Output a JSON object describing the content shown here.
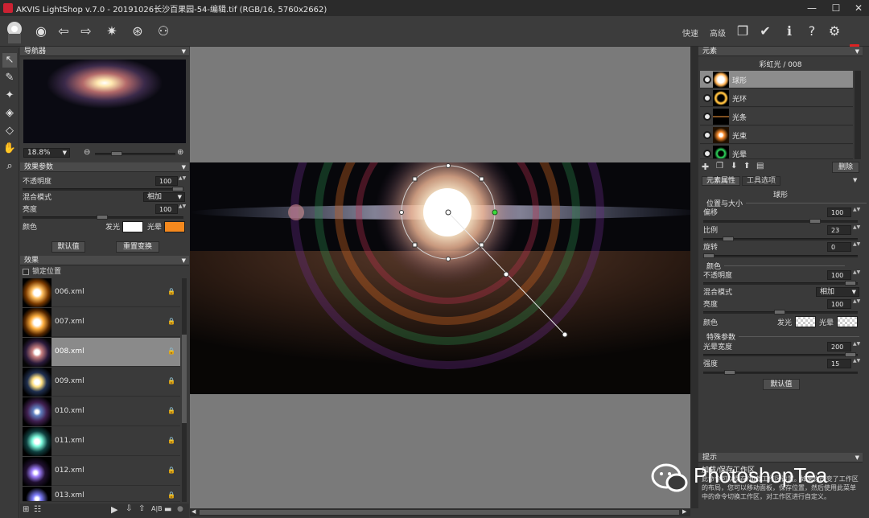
{
  "window": {
    "title": "AKVIS LightShop v.7.0 - 20191026长沙百果园-54-编辑.tif (RGB/16, 5760x2662)",
    "minimize": "—",
    "maximize": "☐",
    "close": "✕"
  },
  "toolbar": {
    "mode_express": "快速",
    "mode_advanced": "高级"
  },
  "navigator": {
    "title": "导航器",
    "zoom": "18.8%"
  },
  "effect_params": {
    "title": "效果参数",
    "opacity_label": "不透明度",
    "opacity_value": "100",
    "blend_label": "混合模式",
    "blend_value": "相加",
    "brightness_label": "亮度",
    "brightness_value": "100",
    "color_label": "颜色",
    "glow_label": "发光",
    "halo_label": "光晕",
    "glow_color": "#ffffff",
    "halo_color": "#f5891e",
    "defaults_button": "默认值",
    "reset_button": "重置变换"
  },
  "effects": {
    "title": "效果",
    "lock_position": "锁定位置",
    "items": [
      {
        "name": "006.xml",
        "lock": "🔒"
      },
      {
        "name": "007.xml",
        "lock": "🔒"
      },
      {
        "name": "008.xml",
        "lock": "🔒",
        "selected": true
      },
      {
        "name": "009.xml",
        "lock": "🔒"
      },
      {
        "name": "010.xml",
        "lock": "🔒"
      },
      {
        "name": "011.xml",
        "lock": "🔒"
      },
      {
        "name": "012.xml",
        "lock": "🔒"
      },
      {
        "name": "013.xml",
        "lock": "🔒"
      }
    ]
  },
  "elements": {
    "title": "元素",
    "effect_name": "彩虹光 / 008",
    "items": [
      {
        "name": "球形",
        "selected": true
      },
      {
        "name": "光环"
      },
      {
        "name": "光条"
      },
      {
        "name": "光束"
      },
      {
        "name": "光晕"
      }
    ],
    "delete_button": "删除"
  },
  "props": {
    "tab_element": "元素属性",
    "tab_tool": "工具选项",
    "element_title": "球形",
    "section_pos": "位置与大小",
    "offset_label": "偏移",
    "offset_value": "100",
    "scale_label": "比例",
    "scale_value": "23",
    "rotate_label": "旋转",
    "rotate_value": "0",
    "section_color": "颜色",
    "opacity_label": "不透明度",
    "opacity_value": "100",
    "blend_label": "混合模式",
    "blend_value": "相加",
    "brightness_label": "亮度",
    "brightness_value": "100",
    "color_label": "颜色",
    "glow_label": "发光",
    "halo_label": "光晕",
    "section_special": "特殊参数",
    "halo_width_label": "光晕宽度",
    "halo_width_value": "200",
    "strength_label": "强度",
    "strength_value": "15",
    "defaults_button": "默认值"
  },
  "hints": {
    "title": "提示",
    "heading": "加载/保存工作区",
    "text": "此命令可以保存/加载工作区设置。如果你改变了工作区的布局，您可以移动面板，保存位置，然后使用此菜单中的命令切换工作区，对工作区进行自定义。"
  },
  "watermark": {
    "text": "PhotoshopTea"
  },
  "colors": {
    "selection_accent": "#8c8c8c",
    "canvas_bg": "#7a7a7a",
    "handle_active": "#3cdc3c"
  }
}
